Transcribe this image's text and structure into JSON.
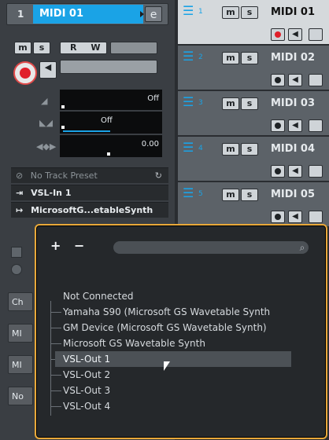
{
  "inspector": {
    "track_number": "1",
    "track_name": "MIDI 01",
    "edit_glyph": "e",
    "buttons": {
      "m": "m",
      "s": "s",
      "r": "R",
      "w": "W"
    },
    "params": [
      {
        "icon": "volume",
        "value": "Off"
      },
      {
        "icon": "pan",
        "value": "Off"
      },
      {
        "icon": "transpose",
        "value": "0.00"
      }
    ],
    "preset": "No Track Preset",
    "input_routing": "VSL-In 1",
    "output_routing": "MicrosoftG...etableSynth",
    "left_side_labels": [
      "Ch",
      "MI",
      "MI",
      "No"
    ]
  },
  "tracks": [
    {
      "num": "1",
      "name": "MIDI 01",
      "selected": true
    },
    {
      "num": "2",
      "name": "MIDI 02",
      "selected": false
    },
    {
      "num": "3",
      "name": "MIDI 03",
      "selected": false
    },
    {
      "num": "4",
      "name": "MIDI 04",
      "selected": false
    },
    {
      "num": "5",
      "name": "MIDI 05",
      "selected": false
    }
  ],
  "track_buttons": {
    "m": "m",
    "s": "s"
  },
  "popup": {
    "plus": "+",
    "minus": "−",
    "items": [
      "Not Connected",
      "Yamaha S90 (Microsoft GS Wavetable Synth",
      "GM Device (Microsoft GS Wavetable Synth)",
      "Microsoft GS Wavetable Synth",
      "VSL-Out 1",
      "VSL-Out 2",
      "VSL-Out 3",
      "VSL-Out 4"
    ],
    "highlighted": "VSL-Out 1"
  },
  "colors": {
    "accent": "#1aa3e6",
    "popup_border": "#e8a83a",
    "record": "#e01f2a"
  }
}
